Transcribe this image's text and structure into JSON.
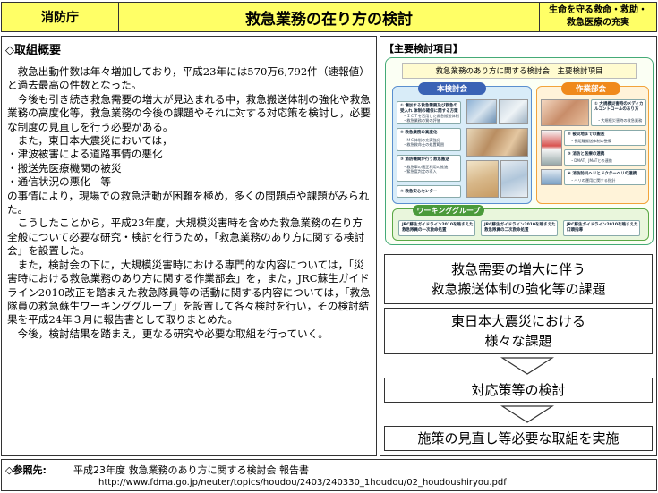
{
  "header": {
    "agency": "消防庁",
    "title": "救急業務の在り方の検討",
    "tagline": [
      "生命を守る救命・救助・",
      "救急医療の充実"
    ]
  },
  "left": {
    "section_title": "◇取組概要",
    "paragraphs": [
      "救急出動件数は年々増加しており，平成23年には570万6,792件（速報値）と過去最高の件数となった。",
      "今後も引き続き救急需要の増大が見込まれる中，救急搬送体制の強化や救急業務の高度化等，救急業務の今後の課題やそれに対する対応策を検討し，必要な制度の見直しを行う必要がある。",
      "また，東日本大震災においては，",
      "・津波被害による道路事情の悪化",
      "・搬送先医療機関の被災",
      "・通信状況の悪化　等",
      "の事情により，現場での救急活動が困難を極め，多くの問題点や課題がみられた。",
      "こうしたことから，平成23年度，大規模災害時を含めた救急業務の在り方全般について必要な研究・検討を行うため，「救急業務のあり方に関する検討会」を設置した。",
      "また，検討会の下に，大規模災害時における専門的な内容については，「災害時における救急業務のあり方に関する作業部会」を，また，JRC蘇生ガイドライン2010改正を踏まえた救急隊員等の活動に関する内容については，「救急隊員の救急蘇生ワーキンググループ」を設置して各々検討を行い，その検討結果を平成24年３月に報告書として取りまとめた。",
      "今後，検討結果を踏まえ，更なる研究や必要な取組を行っていく。"
    ]
  },
  "right": {
    "label": "【主要検討項目】",
    "diagram": {
      "title": "救急業務のあり方に関する検討会　主要検討項目",
      "hk_tab": "本検討会",
      "sg_tab": "作業部会",
      "wg_tab": "ワーキンググループ",
      "hk_items": [
        {
          "t": "① 増加する救急需要及び救急の受入れ 体制の確保に関する方策",
          "s": [
            "・ＩＣＴを活用した救急搬送体制",
            "・救急業務の質の評価"
          ]
        },
        {
          "t": "② 救急業務の高度化",
          "s": [
            "・ＭＣ体制の充実強化",
            "・救急救命士の処置範囲"
          ]
        },
        {
          "t": "③ 消防機関が行う救急搬送",
          "s": [
            "・救急車の適正利用の推進",
            "・緊急度判定の導入"
          ]
        },
        {
          "t": "④ 救急安心センター",
          "s": []
        }
      ],
      "sg_items": [
        {
          "t": "① 大規模災害時のメディカルコントロールのあり方",
          "s": [
            "・大規模災害時の救急業務"
          ]
        },
        {
          "t": "② 被災地までの搬送",
          "s": [
            "・長距離搬送体制の整備"
          ]
        },
        {
          "t": "③ 消防と医療の連携",
          "s": [
            "・DMAT、JMATとの連携"
          ]
        },
        {
          "t": "④ 消防防災ヘリとドクターヘリの連携",
          "s": [
            "・ヘリの運用に関する指針"
          ]
        }
      ],
      "wg_items": [
        "JRC蘇生ガイドライン2010を踏まえた救急隊員の一次救命処置",
        "JRC蘇生ガイドライン2010を踏まえた救急隊員の二次救命処置",
        "JRC蘇生ガイドライン2010を踏まえた口頭指導"
      ]
    },
    "flow": [
      [
        "救急需要の増大に伴う",
        "救急搬送体制の強化等の課題"
      ],
      [
        "東日本大震災における",
        "様々な課題"
      ],
      [
        "対応策等の検討"
      ],
      [
        "施策の見直し等必要な取組を実施"
      ]
    ]
  },
  "footer": {
    "label": "◇参照先:",
    "title": "平成23年度 救急業務のあり方に関する検討会 報告書",
    "url": "http://www.fdma.go.jp/neuter/topics/houdou/2403/240330_1houdou/02_houdoushiryou.pdf"
  },
  "colors": {
    "header_bg": "#ffff66",
    "hk_blue": "#3a63b5",
    "sg_orange": "#f08a1c",
    "wg_green": "#4a9a3a"
  }
}
